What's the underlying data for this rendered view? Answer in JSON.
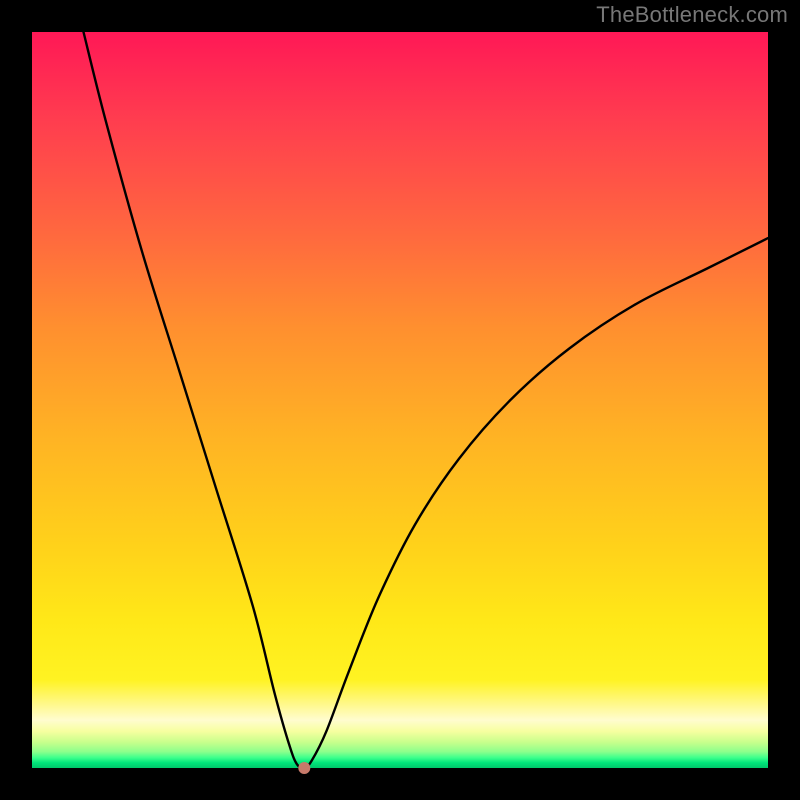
{
  "watermark": "TheBottleneck.com",
  "chart_data": {
    "type": "line",
    "title": "",
    "xlabel": "",
    "ylabel": "",
    "xlim": [
      0,
      100
    ],
    "ylim": [
      0,
      100
    ],
    "grid": false,
    "series": [
      {
        "name": "curve",
        "x": [
          7,
          10,
          15,
          20,
          25,
          30,
          33,
          35,
          36,
          37,
          38,
          40,
          43,
          47,
          52,
          58,
          65,
          73,
          82,
          92,
          100
        ],
        "y": [
          100,
          88,
          70,
          54,
          38,
          22,
          10,
          3,
          0.5,
          0,
          1,
          5,
          13,
          23,
          33,
          42,
          50,
          57,
          63,
          68,
          72
        ]
      }
    ],
    "annotations": [
      {
        "name": "min-point",
        "x": 37,
        "y": 0,
        "marker": "circle",
        "color": "#c77a6a"
      }
    ],
    "background_gradient": {
      "orientation": "vertical",
      "stops": [
        {
          "pos": 0.0,
          "color": "#ff1856"
        },
        {
          "pos": 0.55,
          "color": "#ffd21a"
        },
        {
          "pos": 0.94,
          "color": "#fffccf"
        },
        {
          "pos": 1.0,
          "color": "#00c86a"
        }
      ]
    }
  }
}
